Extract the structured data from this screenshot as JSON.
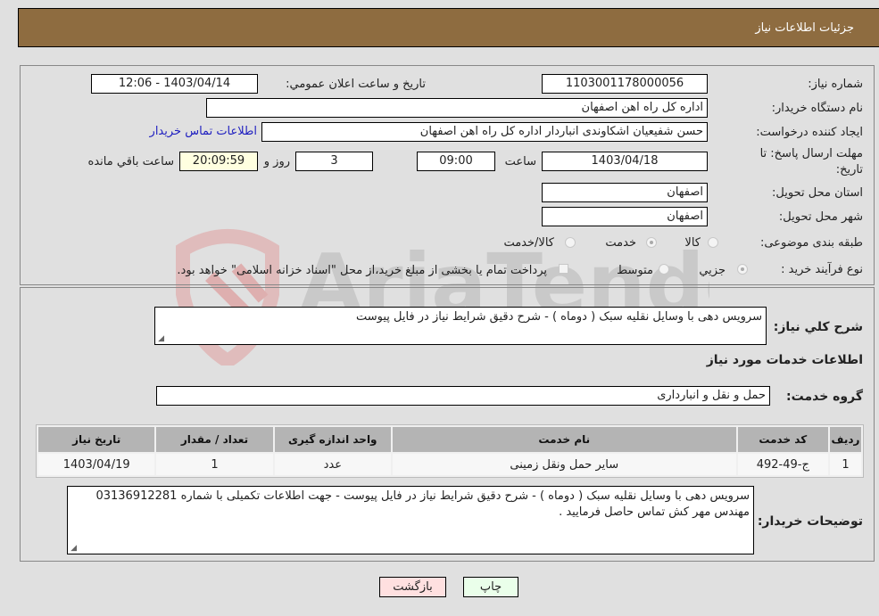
{
  "header": {
    "title": "جزئیات اطلاعات نیاز"
  },
  "form": {
    "need_number": {
      "label": "شماره نیاز:",
      "value": "1103001178000056"
    },
    "announce_datetime": {
      "label": "تاريخ و ساعت اعلان عمومي:",
      "value": "1403/04/14 - 12:06"
    },
    "buyer_org": {
      "label": "نام دستگاه خريدار:",
      "value": "اداره کل راه اهن اصفهان"
    },
    "requester": {
      "label": "ايجاد کننده درخواست:",
      "value": "حسن شفیعیان اشکاوندی انباردار اداره کل راه اهن اصفهان"
    },
    "buyer_contact_link": "اطلاعات تماس خريدار",
    "deadline": {
      "label_line1": "مهلت ارسال پاسخ: تا",
      "label_line2": "تاريخ:",
      "date": "1403/04/18",
      "time_label": "ساعت",
      "time": "09:00",
      "days": "3",
      "days_label": "روز و",
      "remaining": "20:09:59",
      "remaining_label": "ساعت باقي مانده"
    },
    "province": {
      "label": "استان محل تحويل:",
      "value": "اصفهان"
    },
    "city": {
      "label": "شهر محل تحويل:",
      "value": "اصفهان"
    },
    "category": {
      "label": "طبقه بندی موضوعی:",
      "options": [
        "کالا",
        "خدمت",
        "کالا/خدمت"
      ],
      "selected": "خدمت"
    },
    "purchase_type": {
      "label": "نوع فرآيند خريد :",
      "options": [
        "جزيي",
        "متوسط"
      ],
      "selected": "جزيي",
      "treasury_note": "پرداخت تمام يا بخشی از مبلغ خريد،از محل \"اسناد خزانه اسلامی\" خواهد بود."
    }
  },
  "description": {
    "label": "شرح كلي نياز:",
    "value": "سرویس دهی با وسایل نقلیه سبک ( دوماه ) - شرح دقیق شرایط نیاز در فایل پیوست"
  },
  "services_section": {
    "title": "اطلاعات خدمات مورد نياز",
    "group_label": "گروه خدمت:",
    "group_value": "حمل و نقل و انبارداری"
  },
  "table": {
    "headers": [
      "رديف",
      "کد خدمت",
      "نام خدمت",
      "واحد اندازه گيری",
      "تعداد / مقدار",
      "تاريخ نياز"
    ],
    "rows": [
      [
        "1",
        "ج-49-492",
        "ساير حمل ونقل زمينی",
        "عدد",
        "1",
        "1403/04/19"
      ]
    ]
  },
  "buyer_notes": {
    "label": "توضيحات خريدار:",
    "value": "سرویس دهی با وسایل نقلیه سبک ( دوماه ) - شرح دقیق شرایط نیاز در فایل پیوست - جهت اطلاعات تکمیلی با شماره 03136912281 مهندس مهر کش تماس حاصل فرمایید ."
  },
  "buttons": {
    "print": "چاپ",
    "back": "بازگشت"
  },
  "colors": {
    "header_bg": "#8e6c40",
    "print_bg": "#eaffea",
    "back_bg": "#ffe0e0",
    "remaining_bg": "#ffffe0"
  }
}
